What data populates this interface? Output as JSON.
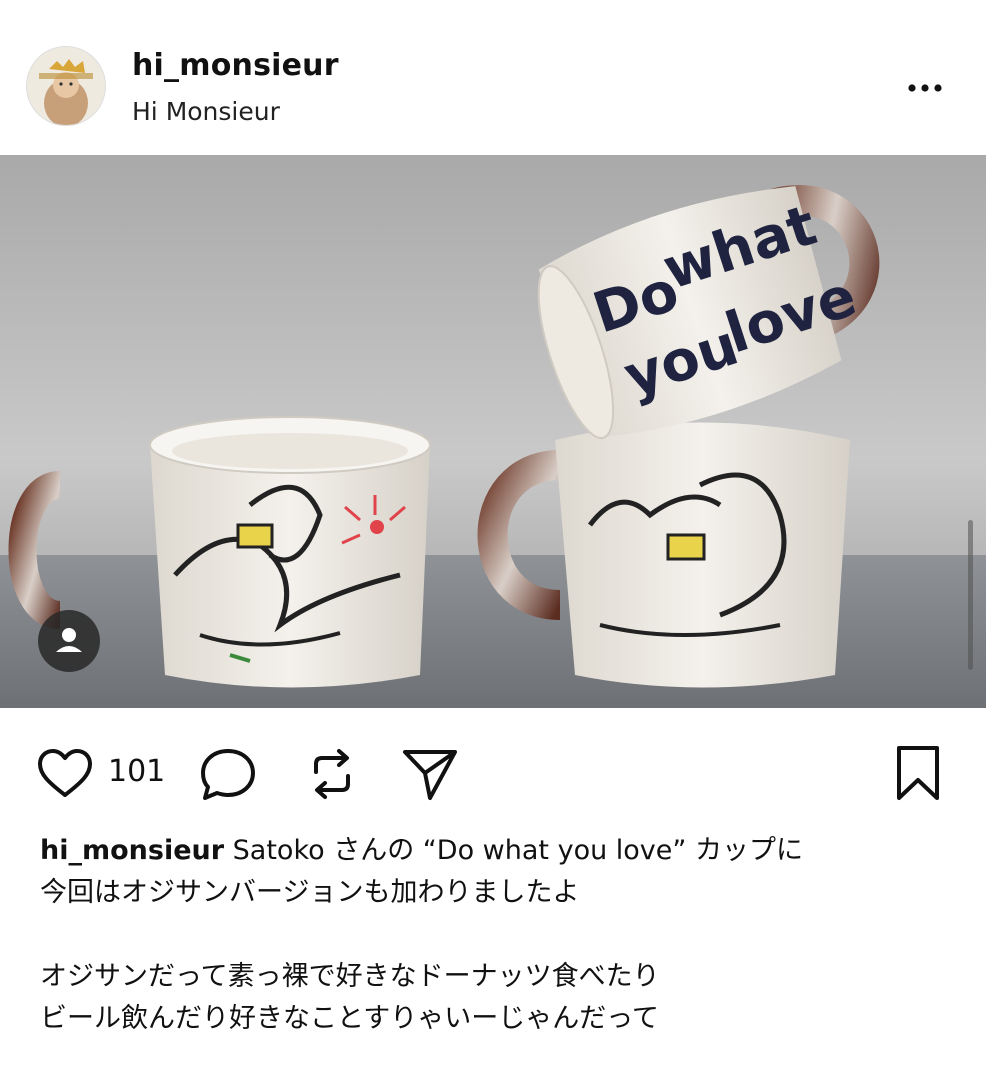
{
  "header": {
    "username": "hi_monsieur",
    "subtitle": "Hi Monsieur",
    "avatar_icon": "profile-avatar-photo",
    "more_icon": "more-options-icon"
  },
  "photo": {
    "alt_description": "Two handmade ceramic mugs with drawings",
    "mug_lettering": [
      "Do",
      "what",
      "you",
      "love"
    ],
    "tag_icon": "person-tag-icon"
  },
  "actions": {
    "like_icon": "heart-icon",
    "like_count": "101",
    "comment_icon": "comment-icon",
    "repost_icon": "repost-icon",
    "share_icon": "send-icon",
    "save_icon": "bookmark-icon"
  },
  "caption": {
    "username": "hi_monsieur",
    "line1_text": "Satoko さんの “Do what you love” カップに",
    "line2": "今回はオジサンバージョンも加わりましたよ",
    "line3": "オジサンだって素っ裸で好きなドーナッツ食べたり",
    "line4": "ビール飲んだり好きなことすりゃいーじゃんだって"
  },
  "colors": {
    "text": "#111111",
    "photo_bg": "#bdbdbd"
  }
}
